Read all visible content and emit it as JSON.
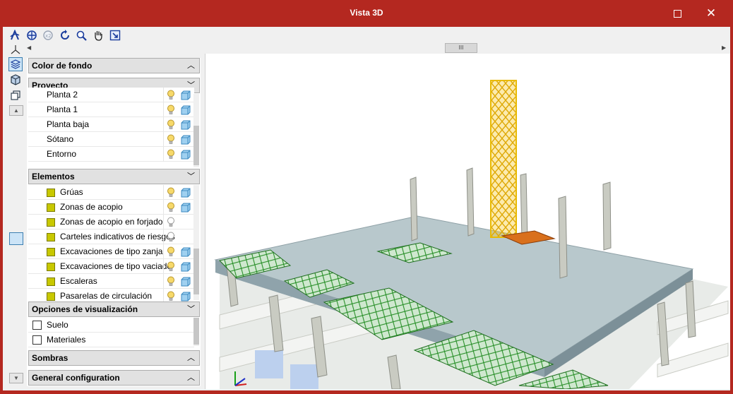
{
  "window": {
    "title": "Vista 3D"
  },
  "sections": {
    "color_fondo": "Color de fondo",
    "proyecto": "Proyecto",
    "elementos": "Elementos",
    "opciones": "Opciones de visualización",
    "sombras": "Sombras",
    "general": "General configuration"
  },
  "proyecto_items": [
    "Planta 2",
    "Planta 1",
    "Planta baja",
    "Sótano",
    "Entorno"
  ],
  "elementos_items": [
    {
      "label": "Grúas",
      "bulb_on": true,
      "cube": true
    },
    {
      "label": "Zonas de acopio",
      "bulb_on": true,
      "cube": true
    },
    {
      "label": "Zonas de acopio en forjado",
      "bulb_on": false,
      "cube": false
    },
    {
      "label": "Carteles indicativos de riesgos",
      "bulb_on": false,
      "cube": false
    },
    {
      "label": "Excavaciones de tipo zanja",
      "bulb_on": true,
      "cube": true
    },
    {
      "label": "Excavaciones de tipo vaciado",
      "bulb_on": true,
      "cube": true
    },
    {
      "label": "Escaleras",
      "bulb_on": true,
      "cube": true
    },
    {
      "label": "Pasarelas de circulación",
      "bulb_on": true,
      "cube": true
    }
  ],
  "opciones_items": [
    "Suelo",
    "Materiales"
  ],
  "icons": {
    "toolbar": [
      "orbit-icon",
      "zoom-extents-icon",
      "zoom-previous-icon",
      "rotate-icon",
      "zoom-window-icon",
      "pan-hand-icon",
      "export-view-icon"
    ],
    "side": [
      "axes-icon",
      "layers-icon",
      "solid-view-icon",
      "wireframe-view-icon"
    ]
  },
  "colors": {
    "titlebar": "#b42820",
    "crane": "#f5c518",
    "net": "#1e8a1e",
    "slab": "#b8c8cc",
    "column": "#c9cbc2"
  },
  "scrollbar_glyph": "III"
}
